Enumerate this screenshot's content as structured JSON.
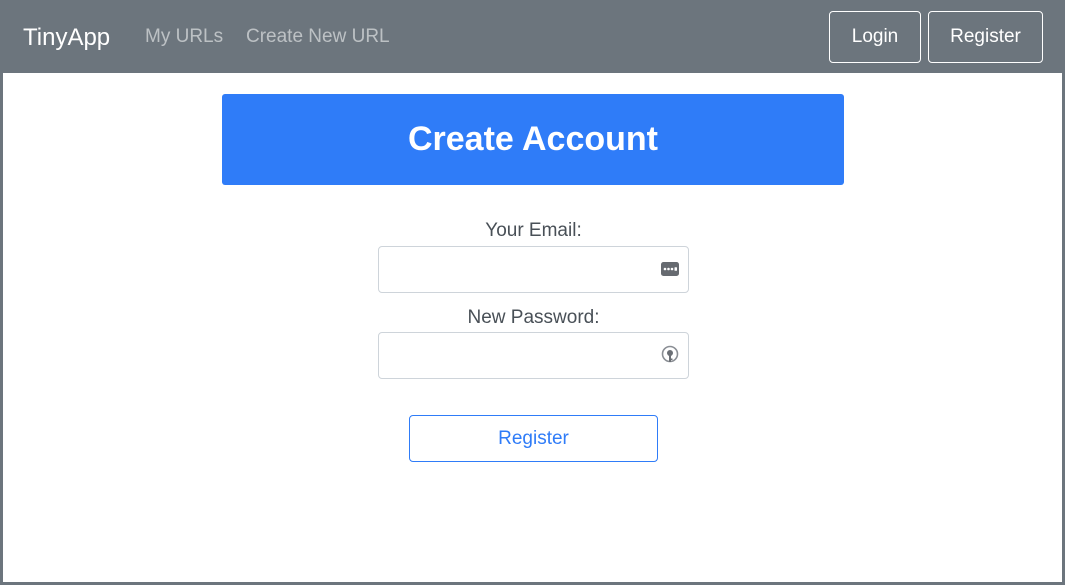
{
  "navbar": {
    "brand": "TinyApp",
    "links": [
      {
        "label": "My URLs"
      },
      {
        "label": "Create New URL"
      }
    ],
    "login_label": "Login",
    "register_label": "Register",
    "background_color": "#6c757d"
  },
  "header": {
    "title": "Create Account",
    "background_color": "#2f7cf8"
  },
  "form": {
    "email_label": "Your Email:",
    "email_value": "",
    "email_icon": "autofill-card-icon",
    "password_label": "New Password:",
    "password_value": "",
    "password_icon": "password-key-icon",
    "submit_label": "Register",
    "accent_color": "#2f7cf8"
  }
}
